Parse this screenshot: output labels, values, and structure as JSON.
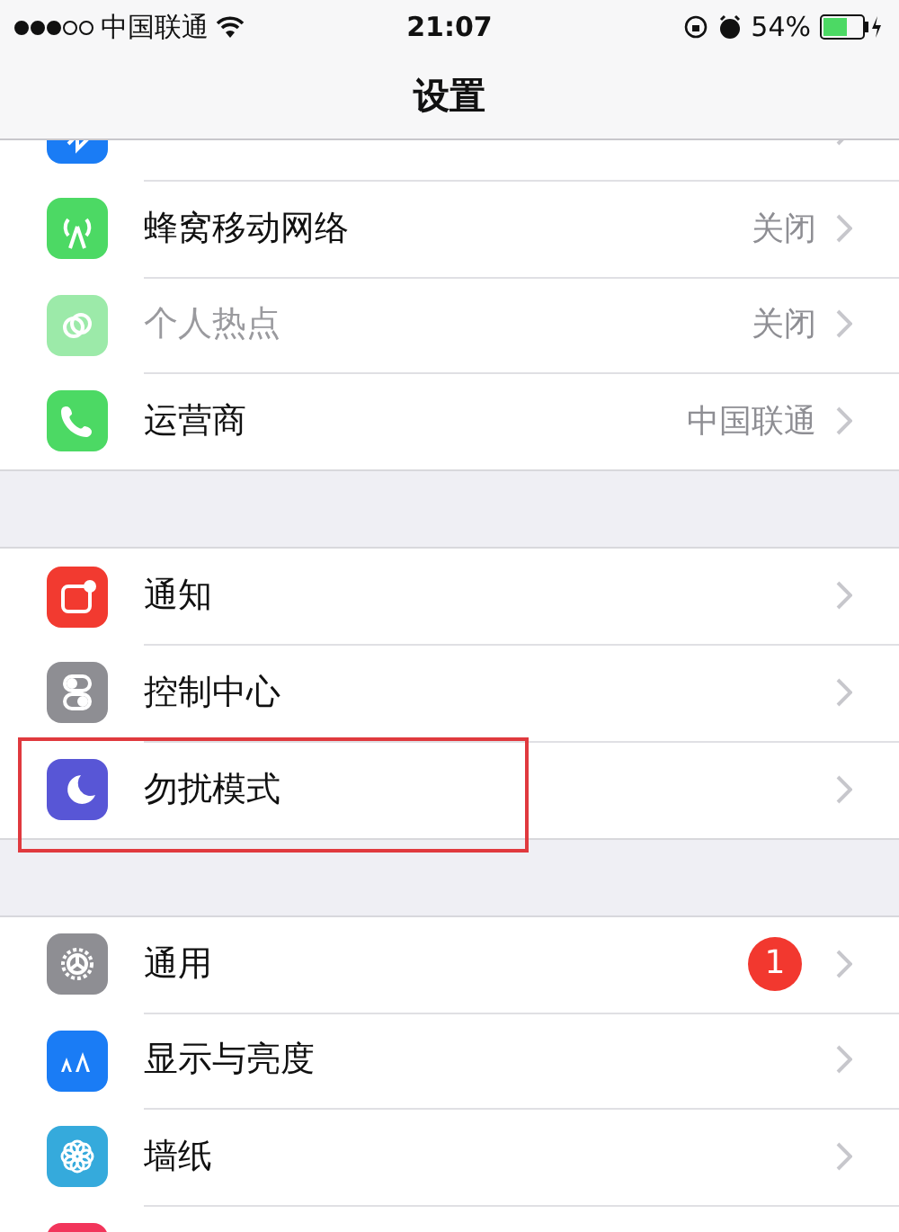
{
  "status_bar": {
    "carrier": "中国联通",
    "time": "21:07",
    "battery": "54%"
  },
  "nav": {
    "title": "设置"
  },
  "groups": [
    {
      "rows": [
        {
          "disabled": false
        },
        {
          "label": "蜂窝移动网络",
          "value": "关闭",
          "disabled": false
        },
        {
          "label": "个人热点",
          "value": "关闭",
          "disabled": true
        },
        {
          "label": "运营商",
          "value": "中国联通",
          "disabled": false
        }
      ]
    },
    {
      "rows": [
        {
          "label": "通知",
          "disabled": false
        },
        {
          "label": "控制中心",
          "disabled": false
        },
        {
          "label": "勿扰模式",
          "disabled": false,
          "highlighted": true
        }
      ]
    },
    {
      "rows": [
        {
          "label": "通用",
          "badge": "1",
          "disabled": false
        },
        {
          "label": "显示与亮度",
          "disabled": false
        },
        {
          "label": "墙纸",
          "disabled": false
        },
        {
          "disabled": false
        }
      ]
    }
  ]
}
